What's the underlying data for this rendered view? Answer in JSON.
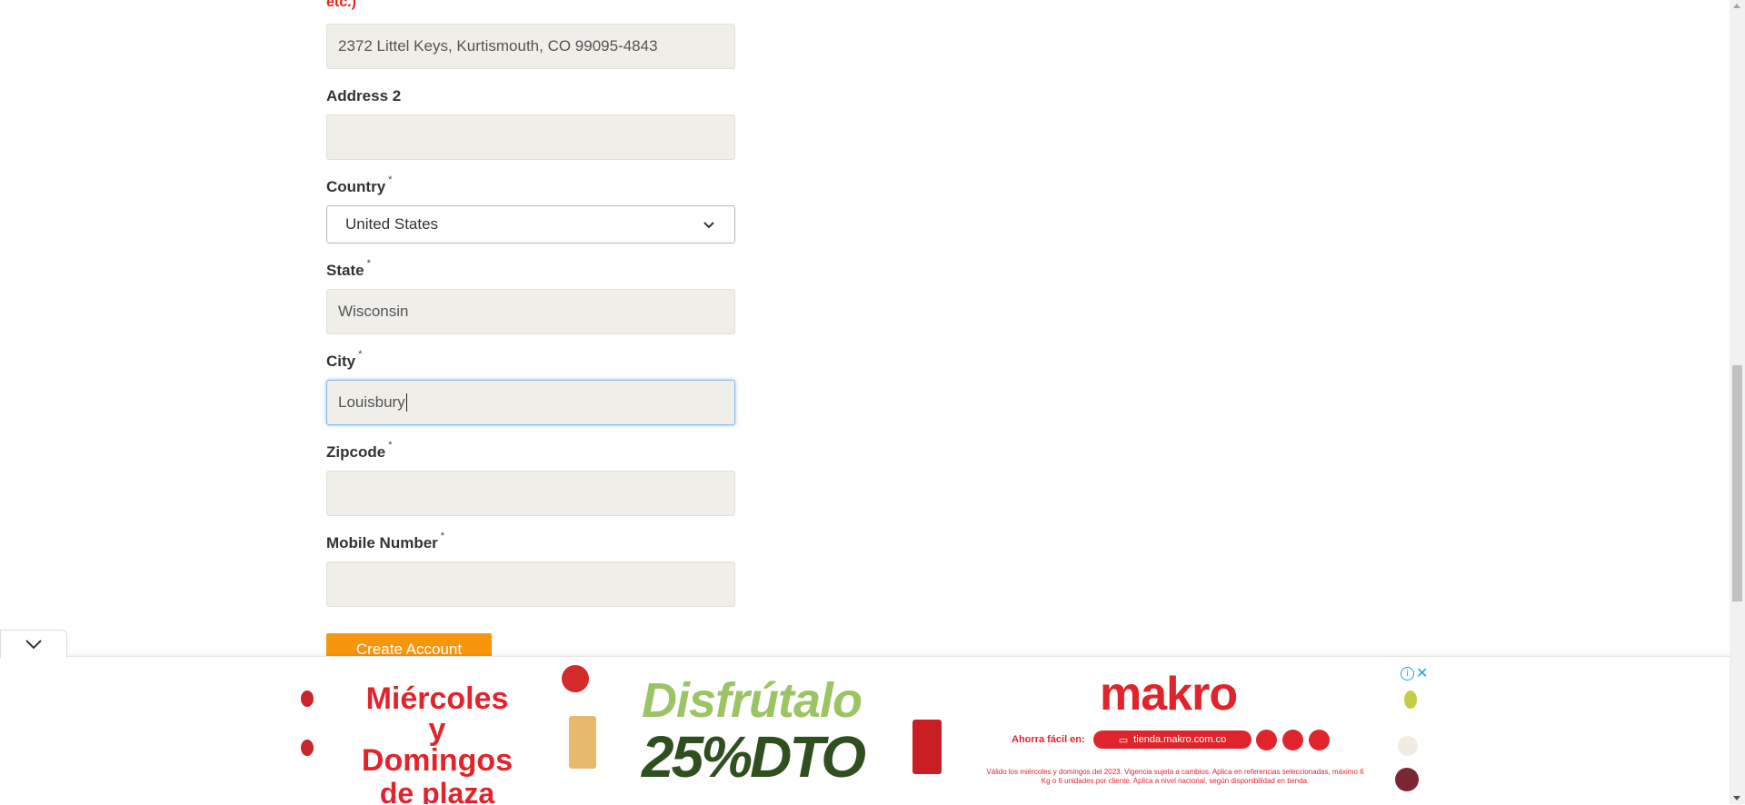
{
  "form": {
    "truncated_label": "etc.)",
    "address1": {
      "value": "2372 Littel Keys, Kurtismouth, CO 99095-4843"
    },
    "address2": {
      "label": "Address 2",
      "value": ""
    },
    "country": {
      "label": "Country",
      "required_mark": "*",
      "selected": "United States"
    },
    "state": {
      "label": "State",
      "required_mark": "*",
      "value": "Wisconsin"
    },
    "city": {
      "label": "City",
      "required_mark": "*",
      "value": "Louisbury"
    },
    "zipcode": {
      "label": "Zipcode",
      "required_mark": "*",
      "value": ""
    },
    "mobile": {
      "label": "Mobile Number",
      "required_mark": "*",
      "value": ""
    },
    "submit_label": "Create Account"
  },
  "ad": {
    "headline_1": "Miércoles y",
    "headline_2": "Domingos",
    "headline_3": "de plaza",
    "promo_1": "Disfrútalo",
    "promo_2": "25%DTO",
    "brand": "makro",
    "cta_prefix": "Ahorra fácil en:",
    "cta_url": "tienda.makro.com.co",
    "fine_print": "Válido los miércoles y domingos del 2023. Vigencia sujeta a cambios. Aplica en referencias seleccionadas, máximo 6 Kg o 6 unidades por cliente. Aplica a nivel nacional, según disponibilidad en tienda.",
    "info_icon": "i",
    "close_icon": "✕"
  },
  "colors": {
    "accent_orange": "#f7960e",
    "brand_red": "#e0242c",
    "promo_green": "#9cc464",
    "promo_dark_green": "#2f4f1e",
    "input_bg": "#efeee9",
    "focus_blue": "#87b8e8"
  },
  "icons": {
    "collapse": "chevron-down-icon",
    "select": "chevron-down-icon",
    "ad_info": "info-icon",
    "ad_close": "close-icon"
  }
}
